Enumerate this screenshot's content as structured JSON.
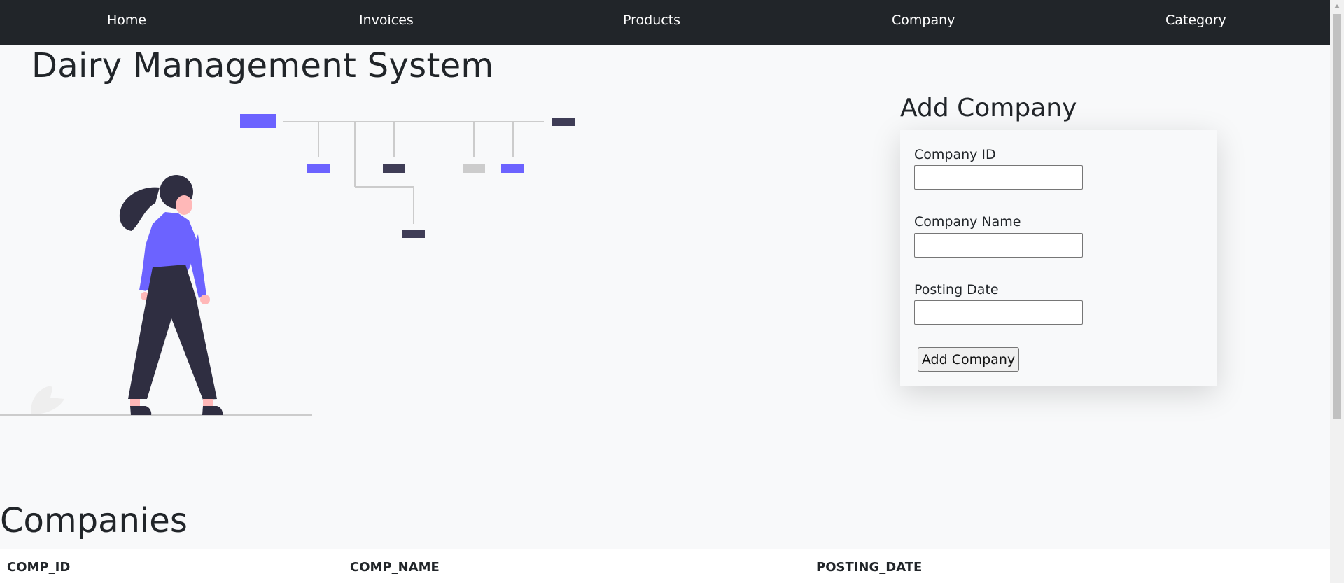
{
  "nav": {
    "items": [
      {
        "label": "Home"
      },
      {
        "label": "Invoices"
      },
      {
        "label": "Products"
      },
      {
        "label": "Company"
      },
      {
        "label": "Category"
      }
    ]
  },
  "header": {
    "title": "Dairy Management System"
  },
  "illustration": {
    "icon": "woman-org-chart-illustration",
    "accent": "#6c63ff",
    "dark": "#3f3d56"
  },
  "form": {
    "heading": "Add Company",
    "fields": [
      {
        "label": "Company ID",
        "value": "",
        "placeholder": ""
      },
      {
        "label": "Company Name",
        "value": "",
        "placeholder": ""
      },
      {
        "label": "Posting Date",
        "value": "",
        "placeholder": ""
      }
    ],
    "submit_label": "Add Company"
  },
  "companies": {
    "title": "Companies",
    "columns": [
      "COMP_ID",
      "COMP_NAME",
      "POSTING_DATE"
    ]
  },
  "colors": {
    "navbar": "#212529",
    "background": "#f8f9fa"
  }
}
